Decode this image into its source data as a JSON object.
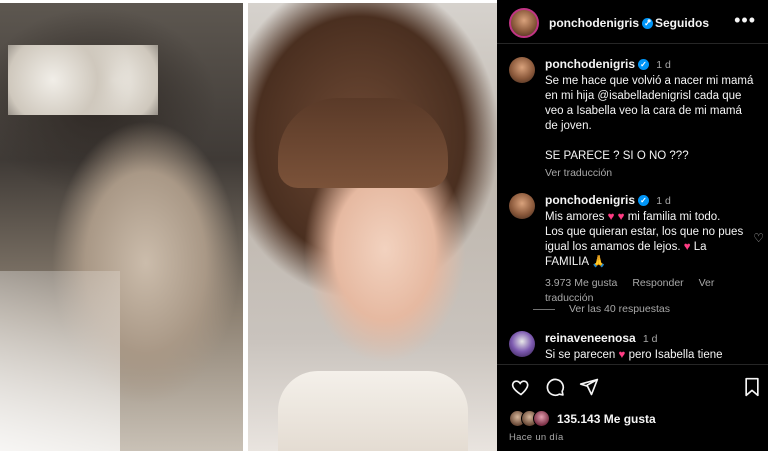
{
  "header": {
    "username": "ponchodenigris",
    "separator": "•",
    "follow_status": "Seguidos",
    "more": "•••"
  },
  "caption": {
    "username": "ponchodenigris",
    "time": "1 d",
    "text": "Se me hace que volvió a nacer mi mamá en mi hija @isabelladenigrisl cada que veo a Isabella veo la cara de mi mamá de joven.\n\nSE PARECE ? SI O NO ???",
    "translate": "Ver traducción"
  },
  "comment1": {
    "username": "ponchodenigris",
    "time": "1 d",
    "line1_a": "Mis amores",
    "line1_b": "mi familia mi todo.",
    "line2": "Los que quieran estar, los que no pues igual los amamos de lejos.",
    "line3_a": "La",
    "line3_b": "FAMILIA",
    "likes": "3.973 Me gusta",
    "reply": "Responder",
    "translate": "Ver traducción",
    "view_replies": "Ver las 40 respuestas"
  },
  "comment2": {
    "username": "reinaveneenosa",
    "time": "1 d",
    "text_a": "Si se parecen",
    "text_b": "pero Isabella tiene"
  },
  "footer": {
    "likes": "135.143 Me gusta",
    "time": "Hace un día"
  },
  "icons": {
    "heart": "heart-icon",
    "comment": "comment-icon",
    "share": "share-icon",
    "bookmark": "bookmark-icon",
    "more": "more-icon",
    "verified": "verified-icon",
    "pray": "pray-emoji"
  },
  "colors": {
    "background": "#000000",
    "text": "#f5f5f5",
    "muted": "#a8a8a8",
    "verified": "#0095f6",
    "heart_emoji": "#ff3c83"
  }
}
